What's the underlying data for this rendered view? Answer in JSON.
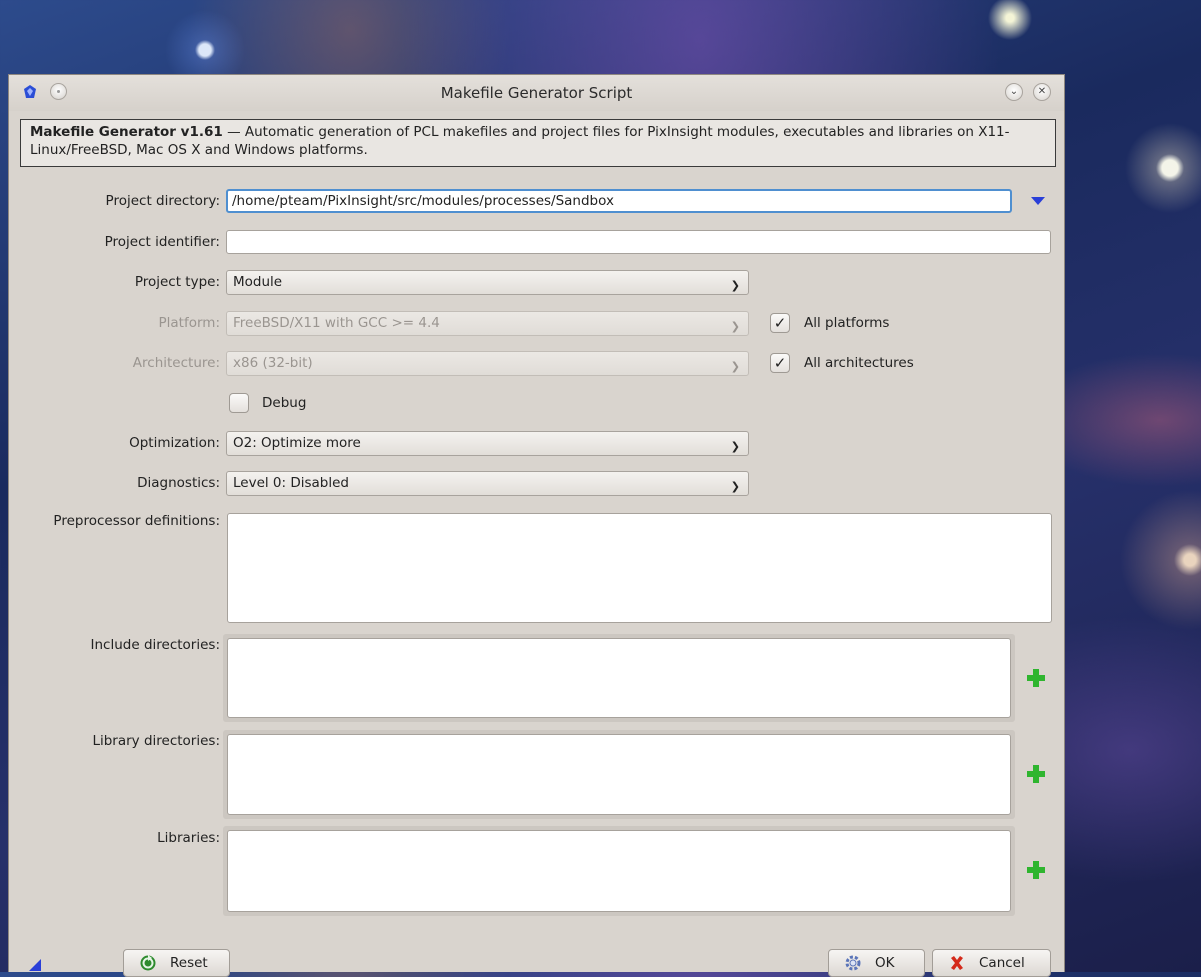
{
  "window": {
    "title": "Makefile Generator Script"
  },
  "info": {
    "heading": "Makefile Generator v1.61",
    "text": " — Automatic generation of PCL makefiles and project files for PixInsight modules, executables and libraries on X11-Linux/FreeBSD, Mac OS X and Windows platforms."
  },
  "form": {
    "project_directory": {
      "label": "Project directory:",
      "value": "/home/pteam/PixInsight/src/modules/processes/Sandbox"
    },
    "project_identifier": {
      "label": "Project identifier:",
      "value": ""
    },
    "project_type": {
      "label": "Project type:",
      "value": "Module"
    },
    "platform": {
      "label": "Platform:",
      "value": "FreeBSD/X11 with GCC >= 4.4",
      "all_label": "All platforms",
      "all_checked": true
    },
    "architecture": {
      "label": "Architecture:",
      "value": "x86 (32-bit)",
      "all_label": "All architectures",
      "all_checked": true
    },
    "debug": {
      "label": "Debug",
      "checked": false
    },
    "optimization": {
      "label": "Optimization:",
      "value": "O2: Optimize more"
    },
    "diagnostics": {
      "label": "Diagnostics:",
      "value": "Level 0: Disabled"
    },
    "preprocessor": {
      "label": "Preprocessor definitions:"
    },
    "include_dirs": {
      "label": "Include directories:"
    },
    "library_dirs": {
      "label": "Library directories:"
    },
    "libraries": {
      "label": "Libraries:"
    }
  },
  "buttons": {
    "reset": "Reset",
    "ok": "OK",
    "cancel": "Cancel"
  },
  "icons": {
    "app_logo": "pixinsight-logo-icon",
    "browse": "dropdown-triangle-icon",
    "add": "green-plus-icon",
    "reset": "reset-icon",
    "ok": "gear-ok-icon",
    "cancel": "red-x-icon",
    "resize": "resize-corner-icon"
  },
  "colors": {
    "accent": "#2a3fd8",
    "add": "#2fb52f",
    "cancel": "#d42a1a",
    "focus": "#4f8fd0"
  }
}
